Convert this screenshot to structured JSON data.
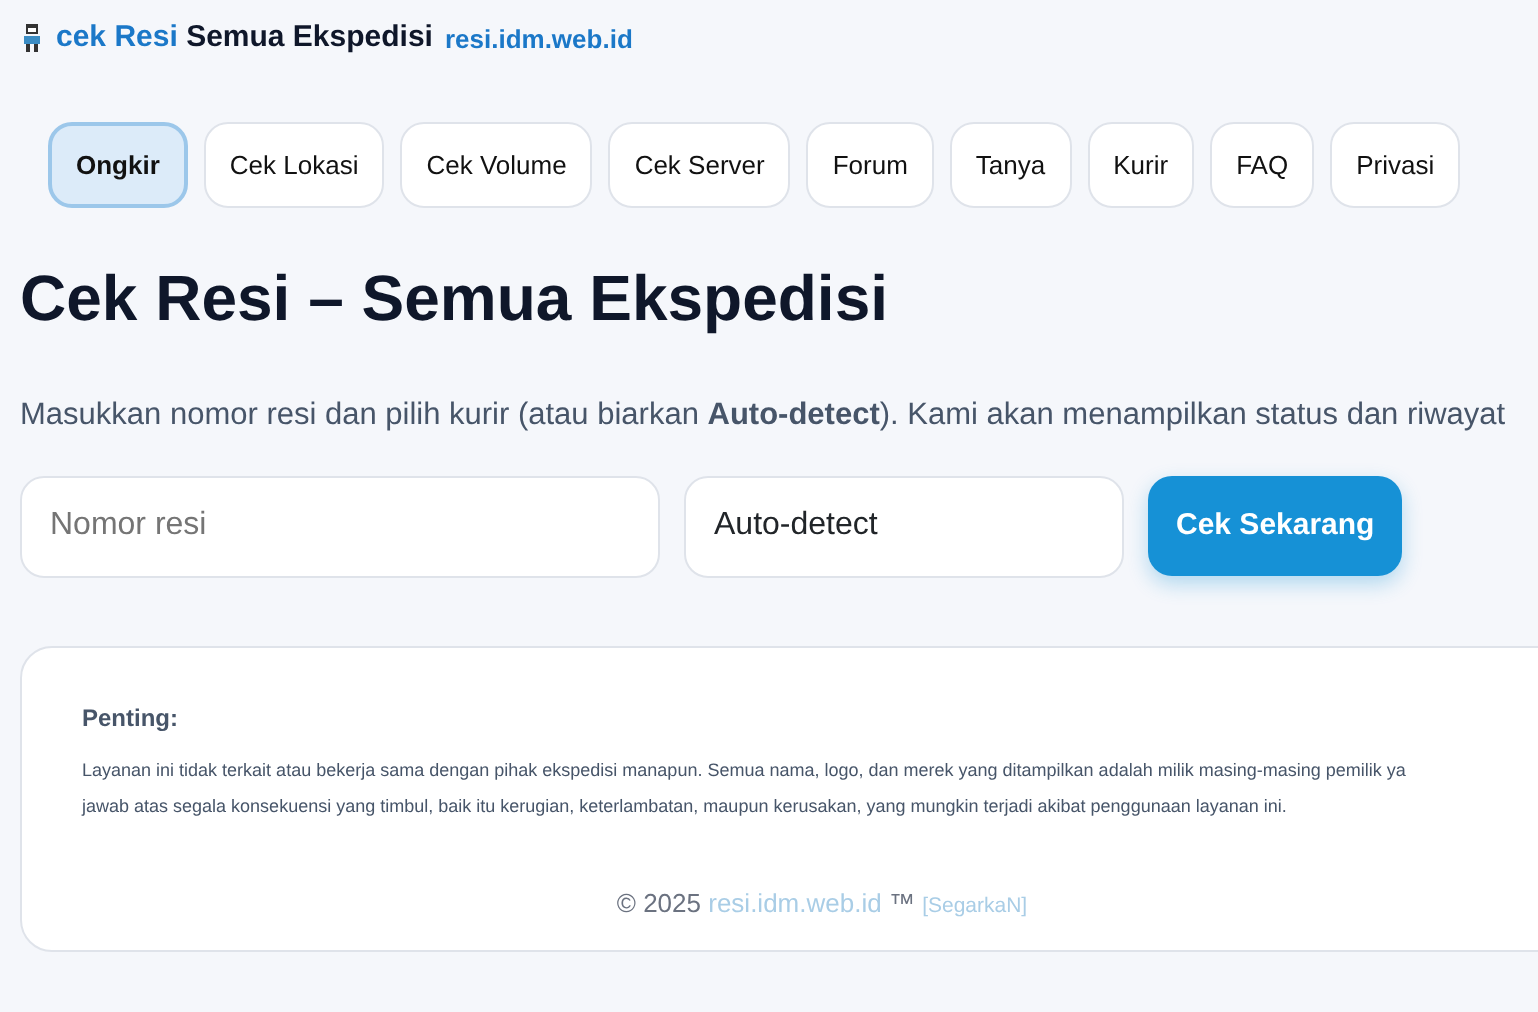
{
  "brand": {
    "accent": "cek Resi",
    "title": "Semua Ekspedisi",
    "domain": "resi.idm.web.id"
  },
  "nav": [
    {
      "label": "Ongkir",
      "selected": true
    },
    {
      "label": "Cek Lokasi",
      "selected": false
    },
    {
      "label": "Cek Volume",
      "selected": false
    },
    {
      "label": "Cek Server",
      "selected": false
    },
    {
      "label": "Forum",
      "selected": false
    },
    {
      "label": "Tanya",
      "selected": false
    },
    {
      "label": "Kurir",
      "selected": false
    },
    {
      "label": "FAQ",
      "selected": false
    },
    {
      "label": "Privasi",
      "selected": false
    }
  ],
  "heading": "Cek Resi – Semua Ekspedisi",
  "intro": "Masukkan nomor resi dan pilih kurir (atau biarkan **Auto-detect**). Kami akan menampilkan status dan riwayat",
  "form": {
    "placeholder": "Nomor resi",
    "courier": "Auto-detect",
    "button": "Cek Sekarang"
  },
  "notice": {
    "title": "Penting:",
    "lines": [
      "Layanan ini tidak terkait atau bekerja sama dengan pihak ekspedisi manapun. Semua nama, logo, dan merek yang ditampilkan adalah milik masing-masing pemilik ya",
      "jawab atas segala konsekuensi yang timbul, baik itu kerugian, keterlambatan, maupun kerusakan, yang mungkin terjadi akibat penggunaan layanan ini."
    ]
  },
  "footer": {
    "copyright": "© 2025",
    "site": "resi.idm.web.id",
    "tm": "™",
    "refresh": "[SegarkaN]"
  }
}
